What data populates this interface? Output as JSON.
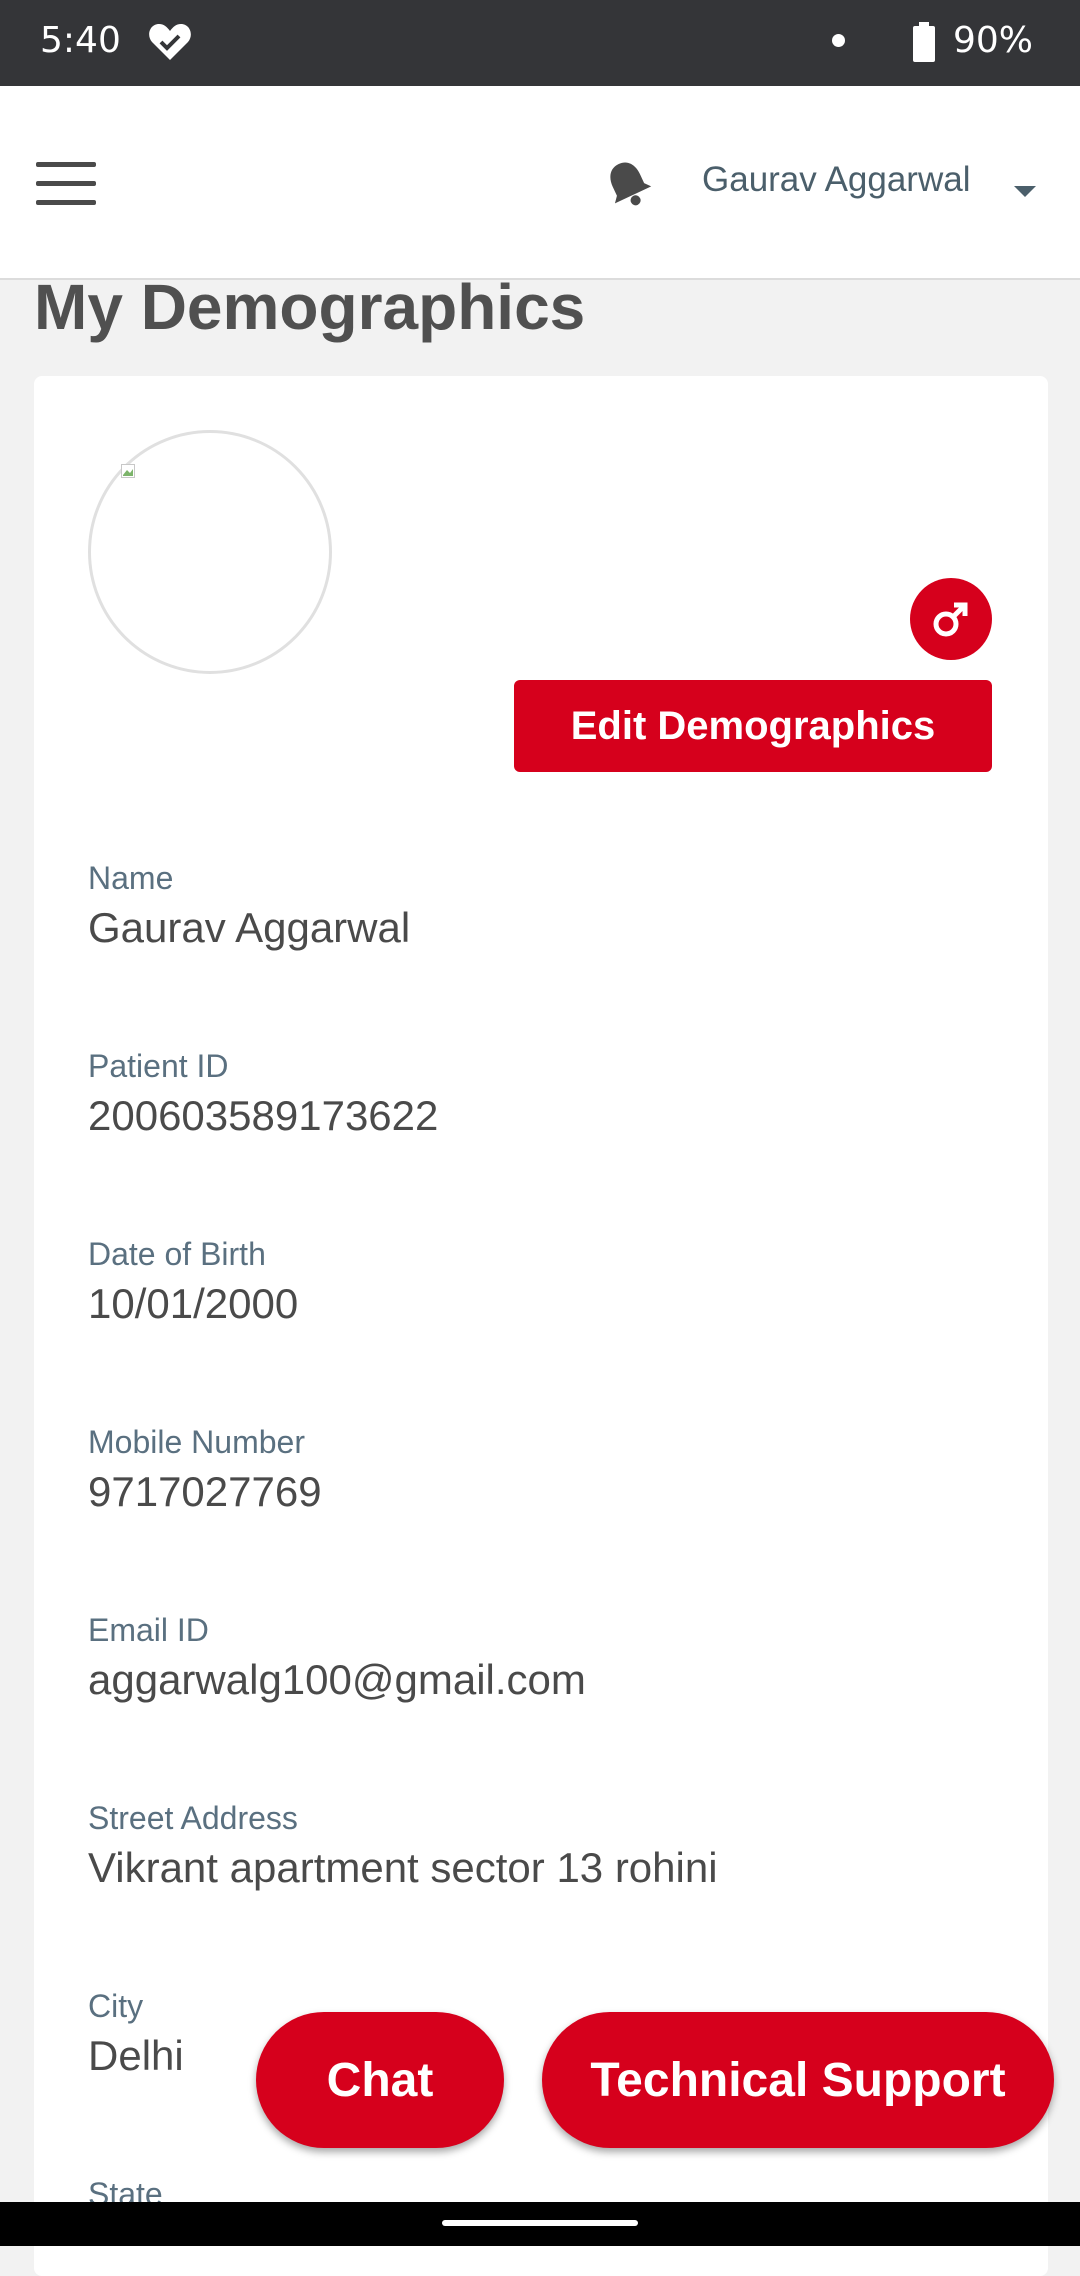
{
  "status_bar": {
    "time": "5:40",
    "battery": "90%"
  },
  "header": {
    "user_name": "Gaurav Aggarwal"
  },
  "page": {
    "title": "My Demographics"
  },
  "profile": {
    "edit_label": "Edit Demographics",
    "fields": [
      {
        "label": "Name",
        "value": "Gaurav Aggarwal"
      },
      {
        "label": "Patient ID",
        "value": "200603589173622"
      },
      {
        "label": "Date of Birth",
        "value": "10/01/2000"
      },
      {
        "label": "Mobile Number",
        "value": "9717027769"
      },
      {
        "label": "Email ID",
        "value": "aggarwalg100@gmail.com"
      },
      {
        "label": "Street Address",
        "value": "Vikrant apartment sector 13 rohini"
      },
      {
        "label": "City",
        "value": "Delhi"
      },
      {
        "label": "State",
        "value": ""
      }
    ]
  },
  "actions": {
    "chat_label": "Chat",
    "support_label": "Technical Support"
  },
  "colors": {
    "accent": "#d6001c",
    "status_bar": "#343538",
    "label_text": "#5a7080",
    "value_text": "#4a4a4a"
  },
  "icons": {
    "menu": "hamburger-menu-icon",
    "notifications": "bell-icon",
    "dropdown": "caret-down-icon",
    "gender": "male-symbol-icon",
    "avatar": "broken-image-icon",
    "status_health": "heart-icon",
    "status_battery": "battery-icon"
  }
}
